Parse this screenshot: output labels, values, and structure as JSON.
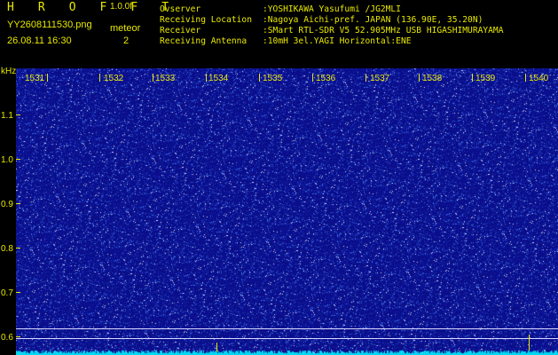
{
  "header": {
    "title": "H R O F F T",
    "version": "1.0.0f",
    "filename": "YY2608111530.png",
    "timestamp": "26.08.11 16:30",
    "meteor_label": "meteor",
    "meteor_count": "2"
  },
  "station_info": [
    {
      "key": "Ovserver",
      "value": ":YOSHIKAWA Yasufumi /JG2MLI"
    },
    {
      "key": "Receiving Location",
      "value": ":Nagoya Aichi-pref. JAPAN (136.90E, 35.20N)"
    },
    {
      "key": "Receiver",
      "value": ":SMart RTL-SDR V5 52.905MHz USB HIGASHIMURAYAMA"
    },
    {
      "key": "Receiving Antenna",
      "value": ":10mH 3el.YAGI Horizontal:ENE"
    }
  ],
  "y_axis": {
    "unit": "kHz",
    "ticks": [
      "1.1",
      "1.0",
      "0.9",
      "0.8",
      "0.7",
      "0.6"
    ]
  },
  "x_axis": {
    "ticks": [
      "1531",
      "1532",
      "1533",
      "1534",
      "1535",
      "1536",
      "1537",
      "1538",
      "1539",
      "1540"
    ]
  },
  "colors": {
    "text": "#e8e800",
    "background": "#000000",
    "spectrum_base": "#0b0e8c",
    "noise_floor": "#00d8f0"
  }
}
